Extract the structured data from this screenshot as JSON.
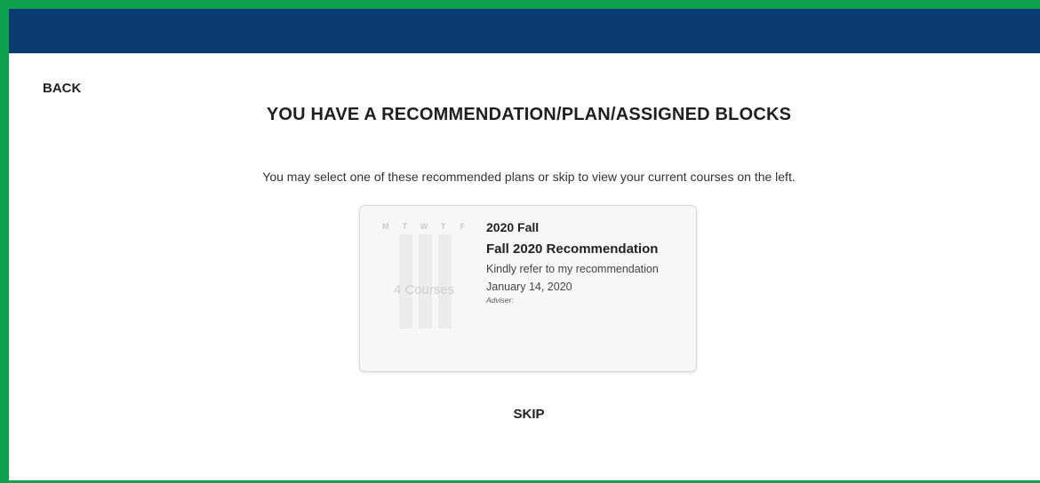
{
  "nav": {
    "back_label": "BACK"
  },
  "page": {
    "title": "YOU HAVE A RECOMMENDATION/PLAN/ASSIGNED BLOCKS",
    "subtitle": "You may select one of these recommended plans or skip to view your current courses on the left."
  },
  "card": {
    "days": [
      "M",
      "T",
      "W",
      "T",
      "F"
    ],
    "course_count_text": "4 Courses",
    "term": "2020 Fall",
    "plan_name": "Fall 2020 Recommendation",
    "description": "Kindly refer to my recommendation",
    "date": "January 14, 2020",
    "adviser_label": "Adviser:"
  },
  "actions": {
    "skip_label": "SKIP"
  },
  "colors": {
    "header": "#0b3a70",
    "frame": "#0ea14d",
    "card_bg": "#f7f7f7"
  }
}
